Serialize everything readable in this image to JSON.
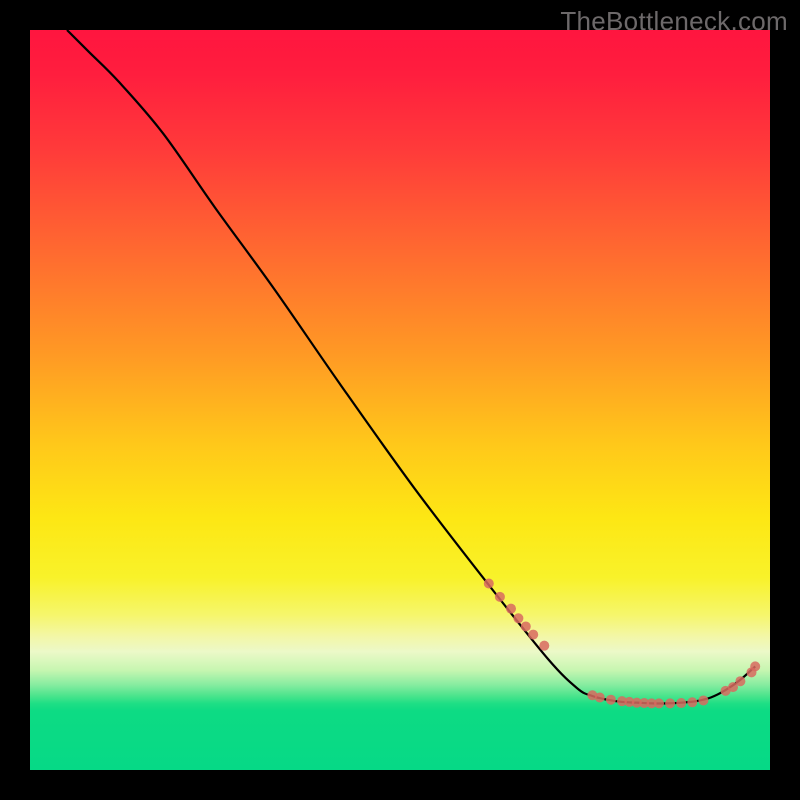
{
  "watermark": "TheBottleneck.com",
  "chart_data": {
    "type": "line",
    "title": "",
    "xlabel": "",
    "ylabel": "",
    "xlim": [
      0,
      100
    ],
    "ylim": [
      0,
      100
    ],
    "grid": false,
    "legend": false,
    "series": [
      {
        "name": "curve",
        "color": "#000000",
        "x": [
          5,
          8,
          12,
          18,
          25,
          33,
          42,
          52,
          62,
          70,
          74,
          76,
          78,
          80,
          82,
          84,
          86,
          88,
          90,
          92,
          94,
          96,
          98
        ],
        "y": [
          100,
          97,
          93,
          86,
          76,
          65,
          52,
          38,
          25,
          15,
          11,
          10,
          9.5,
          9.2,
          9.1,
          9,
          9,
          9.1,
          9.3,
          9.8,
          10.8,
          12.2,
          14
        ]
      }
    ],
    "markers": [
      {
        "name": "points",
        "color": "#d86a5f",
        "radius": 5,
        "x": [
          62,
          63.5,
          65,
          66,
          67,
          68,
          69.5,
          76,
          77,
          78.5,
          80,
          81,
          82,
          83,
          84,
          85,
          86.5,
          88,
          89.5,
          91,
          94,
          95,
          96,
          97.5,
          98
        ],
        "y": [
          25.2,
          23.4,
          21.8,
          20.5,
          19.4,
          18.3,
          16.8,
          10.1,
          9.8,
          9.5,
          9.3,
          9.2,
          9.1,
          9.05,
          9.0,
          9.0,
          9.0,
          9.05,
          9.15,
          9.4,
          10.7,
          11.2,
          12.0,
          13.2,
          14.0
        ]
      }
    ]
  }
}
